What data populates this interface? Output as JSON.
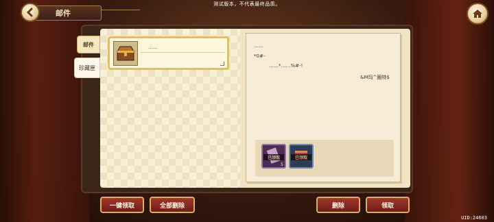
{
  "notice": "测试版本，不代表最终品质。",
  "header": {
    "title": "邮件"
  },
  "tabs": [
    {
      "label": "邮件",
      "active": true
    },
    {
      "label": "珍藏匣",
      "active": false
    }
  ],
  "mail_list": [
    {
      "title": "……",
      "selected": true,
      "icon": "treasure-chest-icon"
    }
  ],
  "detail": {
    "line1": "……",
    "line2": "*0#-",
    "line3": "……*……%#-!",
    "signature": "&M玛^圈特$",
    "attachments": [
      {
        "label": "已领取",
        "count": "5",
        "icon": "scroll-icon"
      },
      {
        "label": "已领取",
        "count": "",
        "icon": "item-box-icon"
      }
    ]
  },
  "buttons": {
    "claim_all": "一键领取",
    "delete_all": "全部删除",
    "delete": "删除",
    "claim": "领取"
  },
  "uid": "UID:24603",
  "colors": {
    "accent_gold": "#e9c04a",
    "button_red": "#8a2b21"
  }
}
